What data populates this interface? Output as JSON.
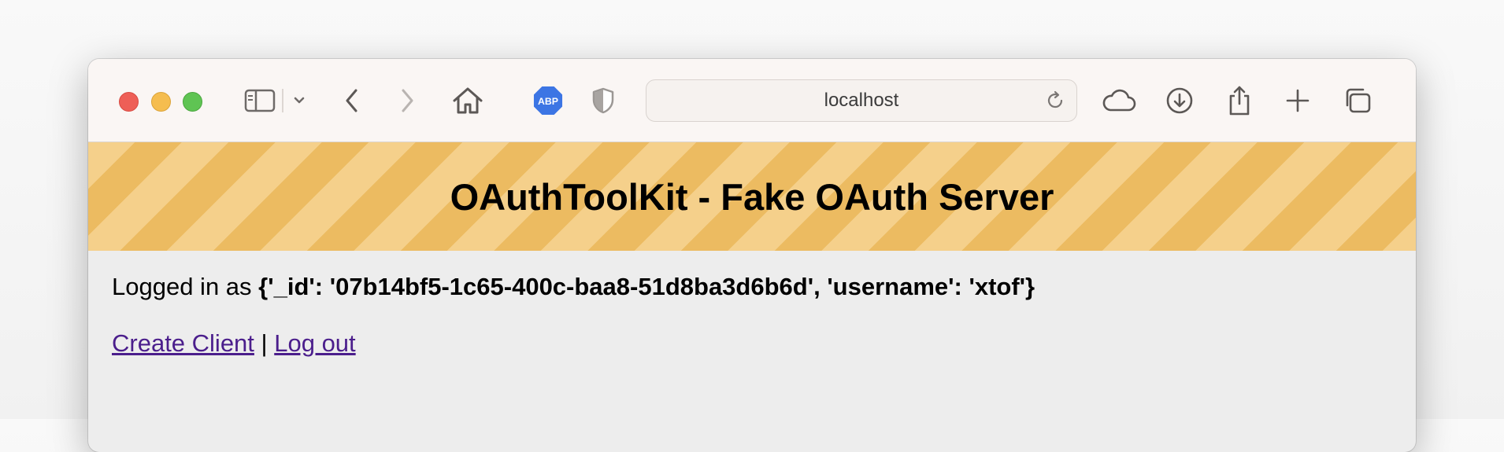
{
  "browser": {
    "url": "localhost",
    "icons": [
      "sidebar-icon",
      "chevron-down-icon",
      "back-icon",
      "forward-icon",
      "home-icon",
      "adblock-icon",
      "privacy-shield-icon",
      "reload-icon",
      "cloud-icon",
      "download-icon",
      "share-icon",
      "new-tab-icon",
      "tabs-overview-icon"
    ],
    "adblock_label": "ABP"
  },
  "page": {
    "title": "OAuthToolKit - Fake OAuth Server",
    "logged_in_prefix": "Logged in as",
    "logged_in_user": "{'_id': '07b14bf5-1c65-400c-baa8-51d8ba3d6b6d', 'username': 'xtof'}",
    "create_client_link": "Create Client",
    "separator": "|",
    "logout_link": "Log out"
  },
  "colors": {
    "stripe_light": "#f5d08b",
    "stripe_dark": "#ecbb61",
    "link": "#4b1e8c",
    "content_bg": "#ededed"
  }
}
